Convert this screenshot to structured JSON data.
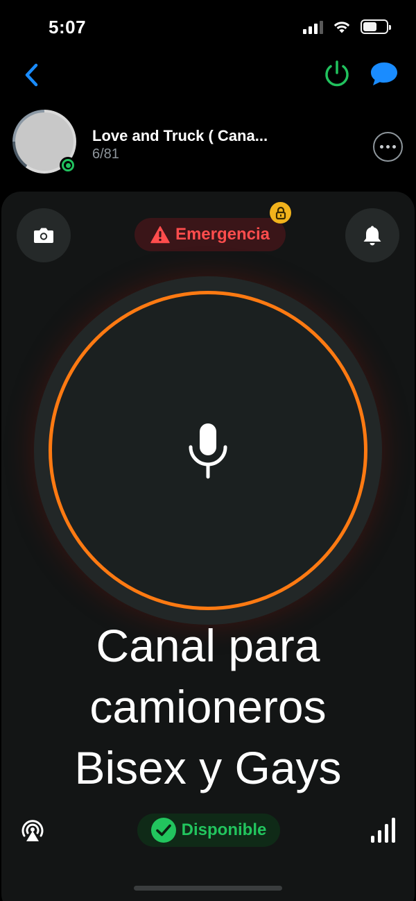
{
  "status_bar": {
    "time": "5:07",
    "battery_level_percent": 60
  },
  "nav": {
    "back_icon": "chevron-left-icon",
    "power_icon": "power-icon",
    "chat_icon": "chat-bubble-icon",
    "power_color": "#21c25e",
    "accent_color": "#1a8cff"
  },
  "channel": {
    "title": "Love and Truck ( Cana...",
    "member_count": "6/81",
    "online_status_color": "#21c25e"
  },
  "controls": {
    "emergency_label": "Emergency",
    "emergency_text": "Emergencia",
    "emergency_color": "#ff4d4d",
    "lock_color": "#f2b31c",
    "ring_color": "#ff7a12"
  },
  "description": {
    "line1": "Canal para",
    "line2": "camioneros",
    "line3": "Bisex y Gays"
  },
  "bottom": {
    "status_label": "Disponible",
    "status_color": "#22c55e"
  }
}
